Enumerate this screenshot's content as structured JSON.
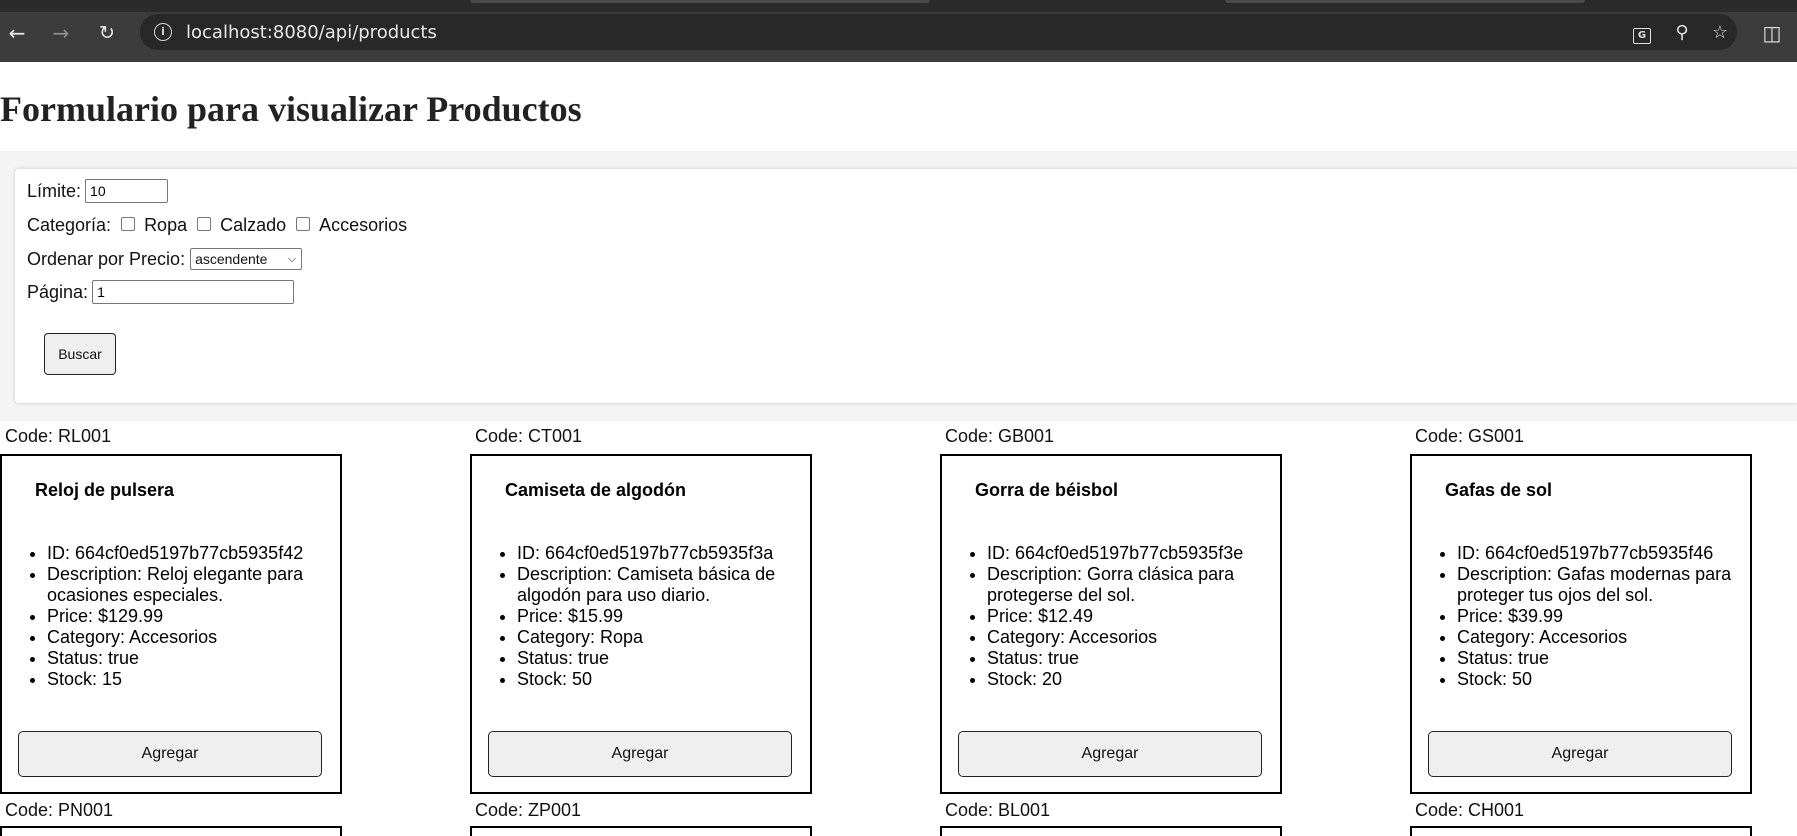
{
  "browser": {
    "url": "localhost:8080/api/products"
  },
  "page": {
    "title": "Formulario para visualizar Productos"
  },
  "form": {
    "limit_label": "Límite:",
    "limit_value": "10",
    "category_label": "Categoría:",
    "categories": [
      "Ropa",
      "Calzado",
      "Accesorios"
    ],
    "sort_label": "Ordenar por Precio:",
    "sort_value": "ascendente",
    "page_label": "Página:",
    "page_value": "1",
    "search_button": "Buscar"
  },
  "products": [
    {
      "code": "Code: RL001",
      "name": "Reloj de pulsera",
      "id": "ID: 664cf0ed5197b77cb5935f42",
      "description": "Description: Reloj elegante para ocasiones especiales.",
      "price": "Price: $129.99",
      "category": "Category: Accesorios",
      "status": "Status: true",
      "stock": "Stock: 15",
      "button": "Agregar"
    },
    {
      "code": "Code: CT001",
      "name": "Camiseta de algodón",
      "id": "ID: 664cf0ed5197b77cb5935f3a",
      "description": "Description: Camiseta básica de algodón para uso diario.",
      "price": "Price: $15.99",
      "category": "Category: Ropa",
      "status": "Status: true",
      "stock": "Stock: 50",
      "button": "Agregar"
    },
    {
      "code": "Code: GB001",
      "name": "Gorra de béisbol",
      "id": "ID: 664cf0ed5197b77cb5935f3e",
      "description": "Description: Gorra clásica para protegerse del sol.",
      "price": "Price: $12.49",
      "category": "Category: Accesorios",
      "status": "Status: true",
      "stock": "Stock: 20",
      "button": "Agregar"
    },
    {
      "code": "Code: GS001",
      "name": "Gafas de sol",
      "id": "ID: 664cf0ed5197b77cb5935f46",
      "description": "Description: Gafas modernas para proteger tus ojos del sol.",
      "price": "Price: $39.99",
      "category": "Category: Accesorios",
      "status": "Status: true",
      "stock": "Stock: 50",
      "button": "Agregar"
    }
  ],
  "next_row_codes": [
    "Code: PN001",
    "Code: ZP001",
    "Code: BL001",
    "Code: CH001"
  ]
}
